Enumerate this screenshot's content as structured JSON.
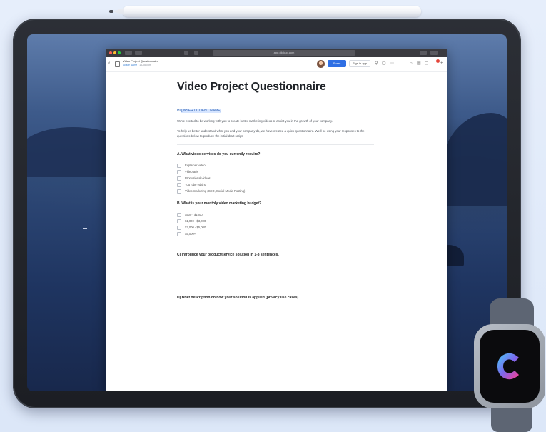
{
  "browser": {
    "url_text": "app.clickup.com",
    "doc_name": "Video Project Questionnaire",
    "breadcrumb_space": "Space Name",
    "breadcrumb_sep": "/",
    "breadcrumb_item": "1 Doc.com",
    "share_label": "Share",
    "signin_label": "Sign in app"
  },
  "document": {
    "title": "Video Project Questionnaire",
    "greeting_prefix": "Hi ",
    "greeting_highlight": "[INSERT CLIENT NAME]",
    "paragraph1": "We're excited to be working with you to create better marketing videos to assist you in the growth of your company.",
    "paragraph2": "To help us better understand what you and your company do, we have created a quick questionnaire. We'll be using your responses to the questions below to produce the initial draft script.",
    "question_a": "A. What video services do you currently require?",
    "options_a": [
      "Explainer video",
      "Video ads",
      "Promotional videos",
      "YouTube editing",
      "Video marketing (SEO, Social Media Posting)"
    ],
    "question_b": "B. What is your monthly video marketing budget?",
    "options_b": [
      "$500 - $1000",
      "$1,000 - $3,000",
      "$3,000 - $5,000",
      "$5,000+"
    ],
    "question_c": "C) Introduce your product/service solution in 1-3 sentences.",
    "question_d": "D) Brief description on how your solution is applied (privacy use cases)."
  },
  "colors": {
    "accent": "#2f6fe4",
    "highlight": "#d6e5ff",
    "clickup_pink": "#fe3c8f",
    "clickup_purple": "#7b68ee",
    "clickup_blue": "#49ccf9"
  },
  "icons": [
    "back-icon",
    "doc-icon",
    "link-icon",
    "bookmark-icon",
    "more-icon",
    "search-icon",
    "layout-icon",
    "notification-icon",
    "plus-icon",
    "clickup-logo-icon"
  ]
}
